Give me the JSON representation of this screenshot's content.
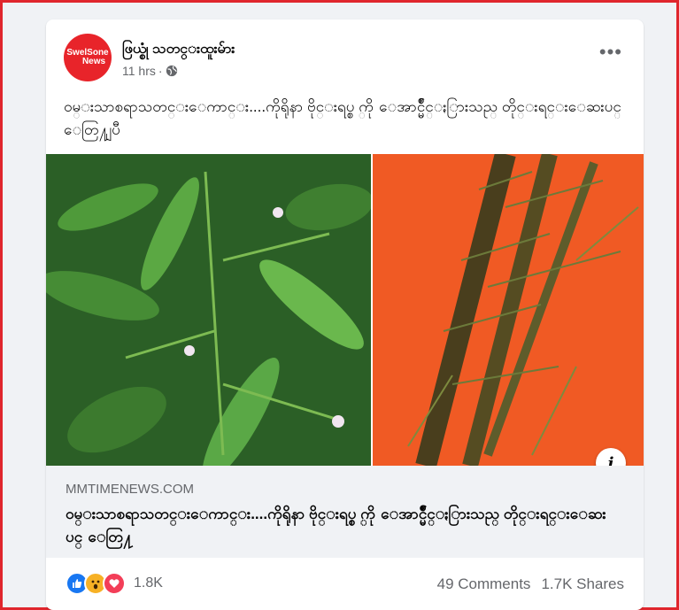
{
  "post": {
    "page_name": "ဖြယ္စုံ သတင္းထူးမ်ား",
    "avatar_text_line1": "SwelSone",
    "avatar_text_line2": "News",
    "time": "11 hrs",
    "separator": "·",
    "privacy_icon": "globe-icon",
    "more_icon": "more-options-icon",
    "more_label": "•••",
    "text": "ဝမ္းသာစရာသတင္းေကာင္း....ကိုရိုနာ ဗိုင္းရပ္စ္ ကို ေအာင္မ်ိဳင္ႏြားသည္ တိုင္းရင္းေဆးပင္ ေတြ႔ျပီ"
  },
  "link_preview": {
    "domain": "MMTIMENEWS.COM",
    "title": "ဝမ္းသာစရာသတင္းေကာင္း....ကိုရိုနာ ဗိုင္းရပ္စ္ ကို ေအာင္မ်ိဳင္ႏြားသည္ တိုင္းရင္းေဆးပင္ ေတြ႔",
    "info_label": "i"
  },
  "engagement": {
    "reaction_icons": [
      "like-icon",
      "wow-icon",
      "love-icon"
    ],
    "reaction_count": "1.8K",
    "comments": "49 Comments",
    "shares": "1.7K Shares"
  },
  "colors": {
    "frame_border": "#e0262d",
    "avatar_bg": "#e8242a",
    "like": "#1877f2",
    "wow": "#f7b125",
    "love": "#f33e58",
    "photo_left_bg": "#2f6b2a",
    "photo_right_bg": "#f05a24"
  }
}
